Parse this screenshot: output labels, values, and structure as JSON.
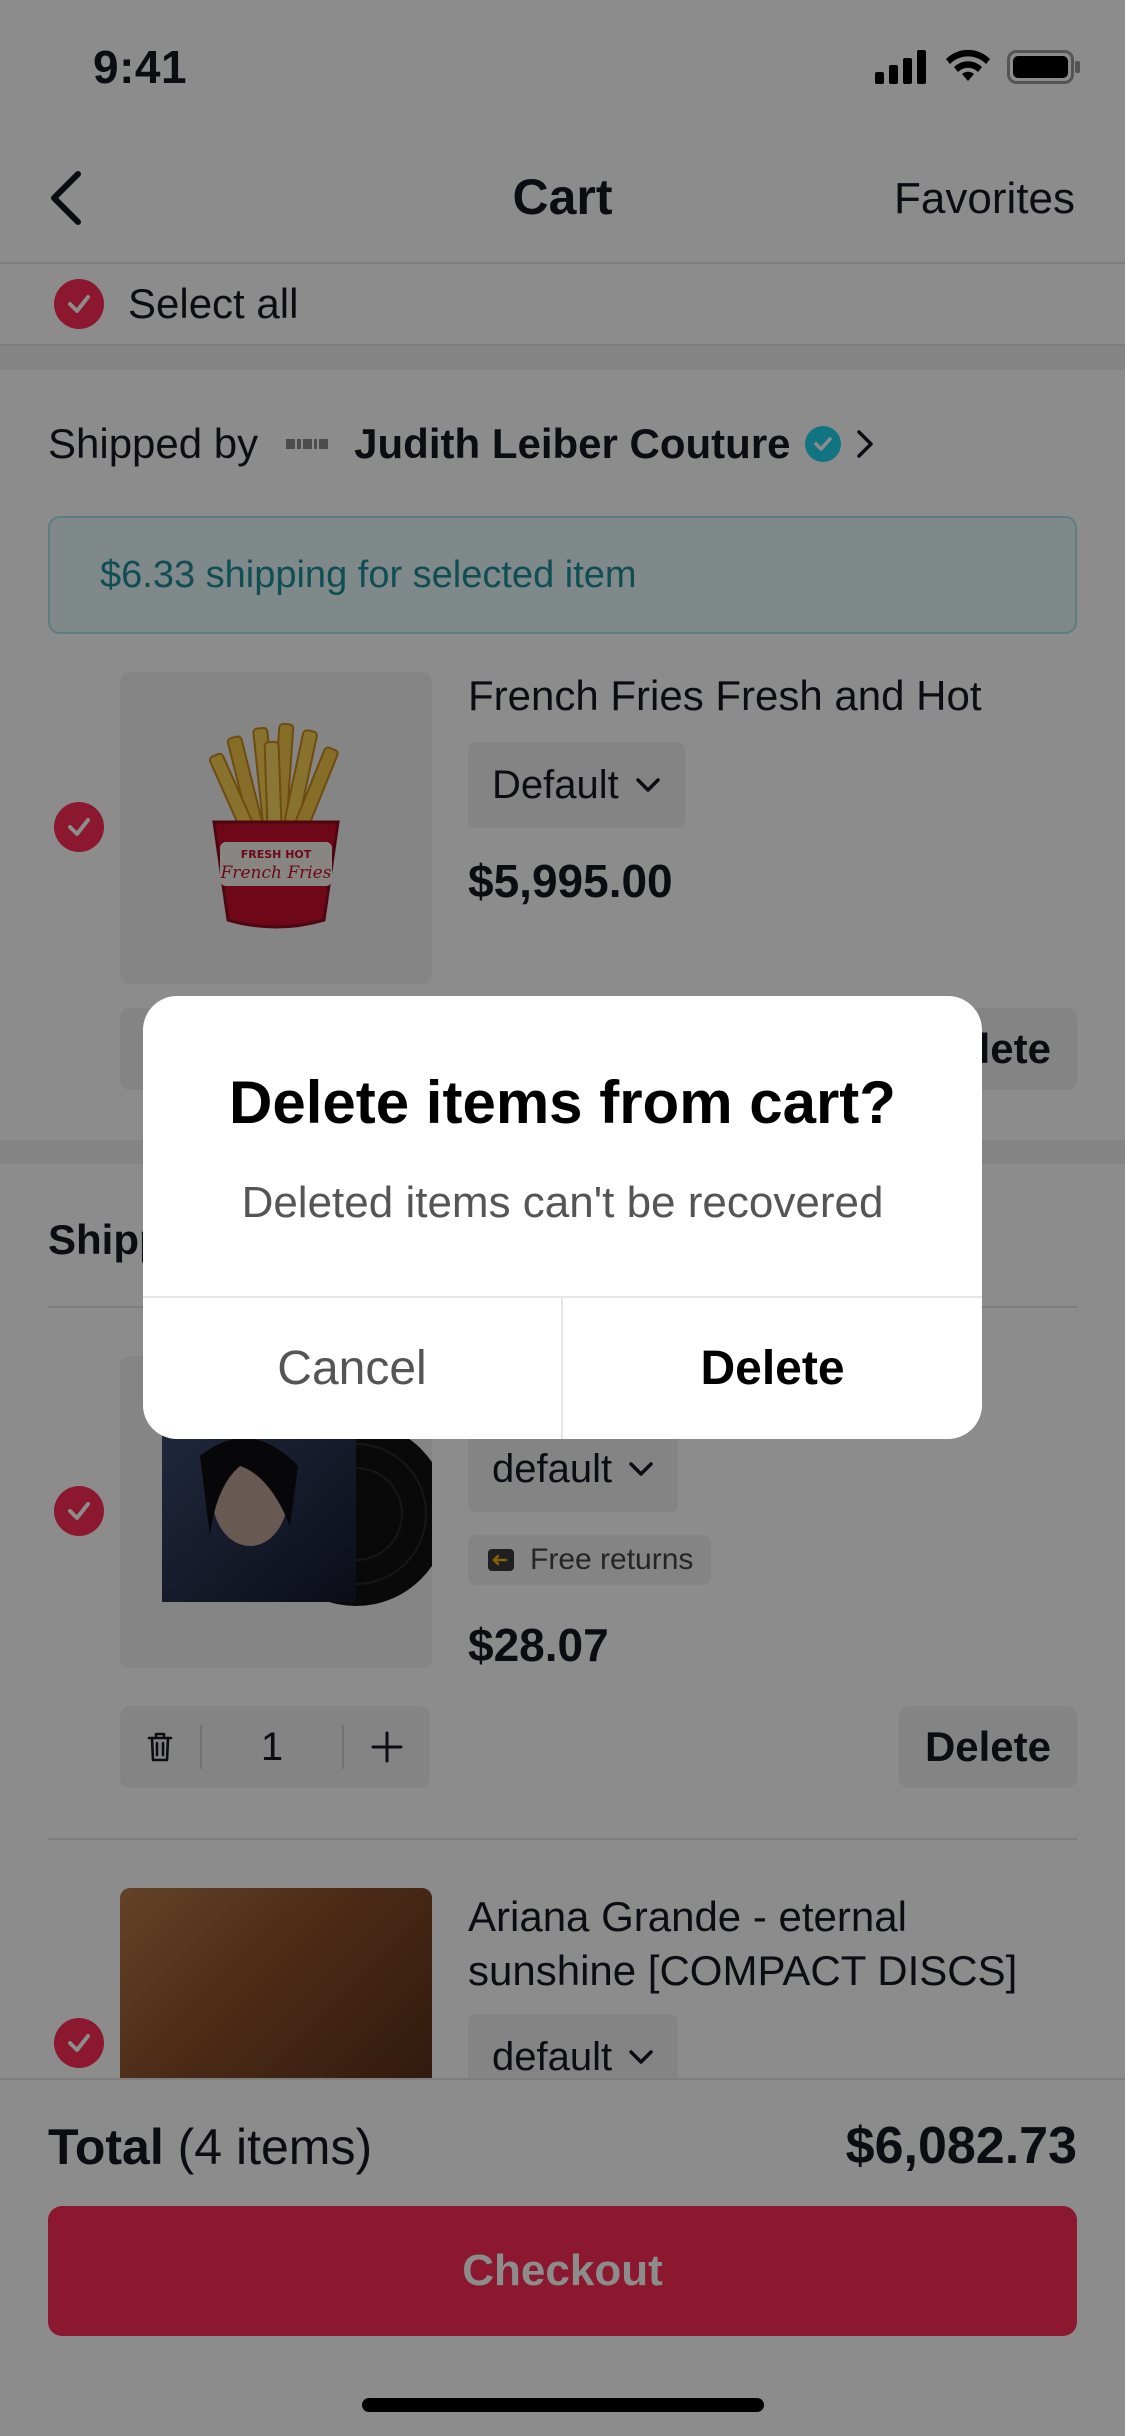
{
  "status_bar": {
    "time": "9:41"
  },
  "header": {
    "title": "Cart",
    "favorites": "Favorites"
  },
  "select_all": {
    "label": "Select all"
  },
  "shop1": {
    "shipped_by": "Shipped by",
    "shop_name": "Judith Leiber Couture",
    "shipping_note": "$6.33 shipping for selected item",
    "item": {
      "name": "French Fries Fresh and Hot",
      "variant": "Default",
      "price": "$5,995.00",
      "delete": "Delete"
    }
  },
  "shop2": {
    "shipped_by": "Shipp",
    "item1": {
      "variant": "default",
      "badge": "Free returns",
      "price": "$28.07",
      "qty": "1",
      "delete": "Delete"
    },
    "item2": {
      "name_line1": "Ariana Grande - eternal",
      "name_line2": "sunshine  [COMPACT DISCS]",
      "variant": "default"
    }
  },
  "footer": {
    "total_label": "Total",
    "total_count": "(4 items)",
    "total_value": "$6,082.73",
    "checkout": "Checkout"
  },
  "dialog": {
    "title": "Delete items from cart?",
    "message": "Deleted items can't be recovered",
    "cancel": "Cancel",
    "confirm": "Delete"
  },
  "colors": {
    "accent": "#fe2c55",
    "verified": "#20d5ec",
    "shipping_note_text": "#1d8f99"
  }
}
